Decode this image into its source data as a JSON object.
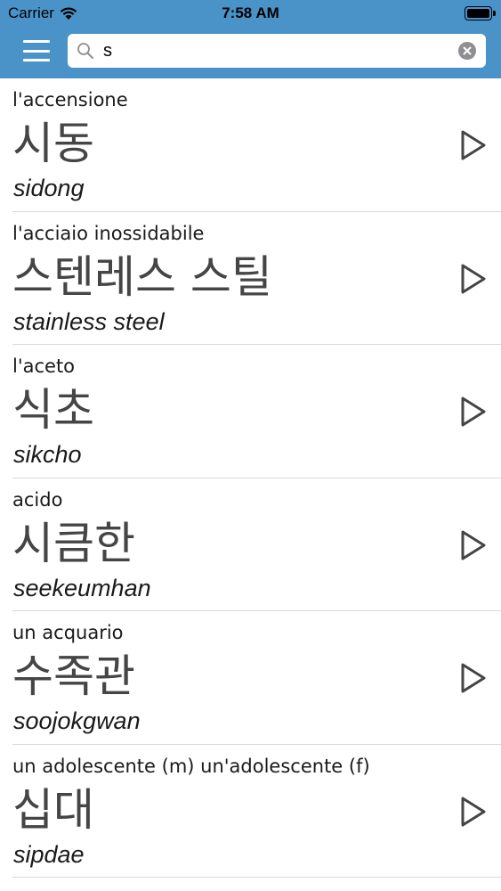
{
  "status_bar": {
    "carrier": "Carrier",
    "time": "7:58 AM",
    "battery_level": 1.0
  },
  "header": {
    "background_color": "#4a93c9",
    "menu_icon": "hamburger-menu-icon",
    "search": {
      "value": "s",
      "search_icon": "magnifier-icon",
      "clear_icon": "clear-circle-icon"
    }
  },
  "entries": [
    {
      "italian": "l'accensione",
      "korean": "시동",
      "romanization": "sidong",
      "action_icon": "play-icon"
    },
    {
      "italian": "l'acciaio inossidabile",
      "korean": "스텐레스 스틸",
      "romanization": "stainless steel",
      "action_icon": "play-icon"
    },
    {
      "italian": "l'aceto",
      "korean": "식초",
      "romanization": "sikcho",
      "action_icon": "play-icon"
    },
    {
      "italian": "acido",
      "korean": "시큼한",
      "romanization": "seekeumhan",
      "action_icon": "play-icon"
    },
    {
      "italian": "un acquario",
      "korean": "수족관",
      "romanization": "soojokgwan",
      "action_icon": "play-icon"
    },
    {
      "italian": "un adolescente (m)  un'adolescente (f)",
      "korean": "십대",
      "romanization": "sipdae",
      "action_icon": "play-icon"
    }
  ]
}
